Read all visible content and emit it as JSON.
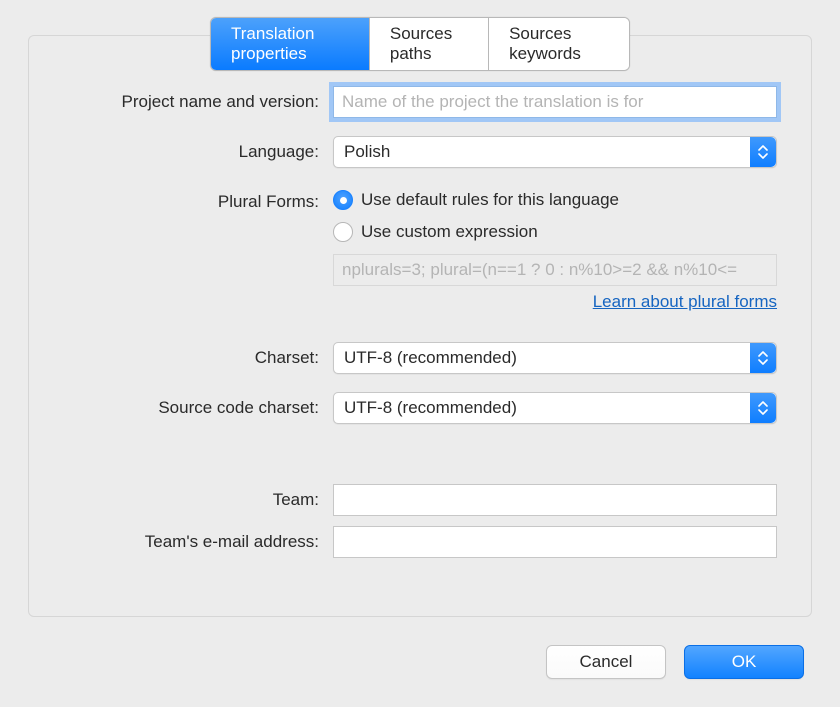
{
  "tabs": {
    "translation_properties": "Translation properties",
    "sources_paths": "Sources paths",
    "sources_keywords": "Sources keywords"
  },
  "labels": {
    "project_name": "Project name and version:",
    "language": "Language:",
    "plural_forms": "Plural Forms:",
    "charset": "Charset:",
    "source_charset": "Source code charset:",
    "team": "Team:",
    "team_email": "Team's e-mail address:"
  },
  "fields": {
    "project_name_placeholder": "Name of the project the translation is for",
    "language_value": "Polish",
    "plural_default_label": "Use default rules for this language",
    "plural_custom_label": "Use custom expression",
    "plural_expression_value": "nplurals=3; plural=(n==1 ? 0 : n%10>=2 && n%10<=",
    "charset_value": "UTF-8 (recommended)",
    "source_charset_value": "UTF-8 (recommended)",
    "team_value": "",
    "team_email_value": ""
  },
  "links": {
    "plural_help": "Learn about plural forms"
  },
  "buttons": {
    "cancel": "Cancel",
    "ok": "OK"
  }
}
